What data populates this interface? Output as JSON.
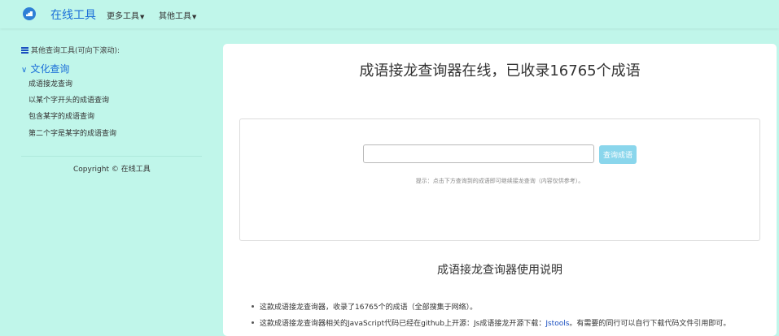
{
  "nav": {
    "brand": "在线工具",
    "more_tools": "更多工具",
    "other_tools": "其他工具"
  },
  "sidebar": {
    "heading": "其他查询工具(可向下滚动):",
    "category": "文化查询",
    "items": [
      {
        "label": "成语接龙查询"
      },
      {
        "label": "以某个字开头的成语查询"
      },
      {
        "label": "包含某字的成语查询"
      },
      {
        "label": "第二个字是某字的成语查询"
      }
    ],
    "copyright": "Copyright © 在线工具"
  },
  "main": {
    "title": "成语接龙查询器在线，已收录16765个成语",
    "search": {
      "value": "",
      "placeholder": "",
      "button_label": "查询成语"
    },
    "hint": "提示：点击下方查询到的成语即可继续接龙查询（内容仅供参考）。",
    "section_title": "成语接龙查询器使用说明",
    "info": [
      {
        "text": "这款成语接龙查询器，收录了16765个的成语（全部搜集于网络）。"
      },
      {
        "text_before": "这款成语接龙查询器相关的JavaScript代码已经在github上开源：Js成语接龙开源下载：",
        "link": "Jstools",
        "text_after": "。有需要的同行可以自行下载代码文件引用即可。"
      }
    ]
  },
  "colors": {
    "background": "#c0f6ea",
    "brand": "#1a6ed8",
    "button": "#8ad6ec"
  }
}
